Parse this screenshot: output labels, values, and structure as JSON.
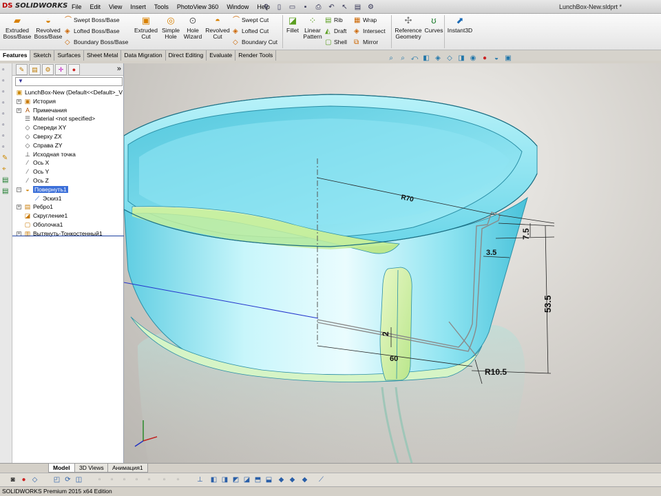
{
  "app": {
    "logo_prefix": "DS",
    "logo_name": "SOLIDWORKS",
    "document_title": "LunchBox-New.sldprt *"
  },
  "menu": [
    "File",
    "Edit",
    "View",
    "Insert",
    "Tools",
    "PhotoView 360",
    "Window",
    "Help"
  ],
  "ribbon": {
    "extruded_boss": "Extruded Boss/Base",
    "revolved_boss": "Revolved Boss/Base",
    "swept_boss": "Swept Boss/Base",
    "lofted_boss": "Lofted Boss/Base",
    "boundary_boss": "Boundary Boss/Base",
    "extruded_cut": "Extruded Cut",
    "simple_hole": "Simple Hole",
    "hole_wizard": "Hole Wizard",
    "revolved_cut": "Revolved Cut",
    "swept_cut": "Swept Cut",
    "lofted_cut": "Lofted Cut",
    "boundary_cut": "Boundary Cut",
    "fillet": "Fillet",
    "linear_pattern": "Linear Pattern",
    "rib": "Rib",
    "draft": "Draft",
    "shell": "Shell",
    "wrap": "Wrap",
    "intersect": "Intersect",
    "mirror": "Mirror",
    "reference_geometry": "Reference Geometry",
    "curves": "Curves",
    "instant3d": "Instant3D"
  },
  "command_tabs": [
    "Features",
    "Sketch",
    "Surfaces",
    "Sheet Metal",
    "Data Migration",
    "Direct Editing",
    "Evaluate",
    "Render Tools"
  ],
  "tree": {
    "root": "LunchBox-New  (Default<<Default>_V",
    "items": [
      {
        "label": "История",
        "icon": "history-icon",
        "glyph": "▣",
        "color": "#c87800",
        "expander": "+"
      },
      {
        "label": "Примечания",
        "icon": "annotations-icon",
        "glyph": "A",
        "color": "#b05000",
        "expander": "+"
      },
      {
        "label": "Material <not specified>",
        "icon": "material-icon",
        "glyph": "☰",
        "color": "#555",
        "expander": ""
      },
      {
        "label": "Спереди XY",
        "icon": "plane-icon",
        "glyph": "◇",
        "color": "#444",
        "expander": ""
      },
      {
        "label": "Сверху ZX",
        "icon": "plane-icon",
        "glyph": "◇",
        "color": "#444",
        "expander": ""
      },
      {
        "label": "Справа ZY",
        "icon": "plane-icon",
        "glyph": "◇",
        "color": "#444",
        "expander": ""
      },
      {
        "label": "Исходная точка",
        "icon": "origin-icon",
        "glyph": "⊥",
        "color": "#333",
        "expander": ""
      },
      {
        "label": "Ось X",
        "icon": "axis-icon",
        "glyph": "⁄",
        "color": "#555",
        "expander": ""
      },
      {
        "label": "Ось Y",
        "icon": "axis-icon",
        "glyph": "⁄",
        "color": "#555",
        "expander": ""
      },
      {
        "label": "Ось Z",
        "icon": "axis-icon",
        "glyph": "⁄",
        "color": "#555",
        "expander": ""
      },
      {
        "label": "Повернуть1",
        "icon": "revolve-icon",
        "glyph": "◒",
        "color": "#d08000",
        "expander": "−",
        "selected": true
      },
      {
        "label": "Эскиз1",
        "icon": "sketch-icon",
        "glyph": "⟋",
        "color": "#1050c0",
        "expander": "",
        "indent": true
      },
      {
        "label": "Ребро1",
        "icon": "rib-icon",
        "glyph": "▤",
        "color": "#c87800",
        "expander": "+"
      },
      {
        "label": "Скругление1",
        "icon": "fillet-icon",
        "glyph": "◪",
        "color": "#c87800",
        "expander": ""
      },
      {
        "label": "Оболочка1",
        "icon": "shell-icon",
        "glyph": "▢",
        "color": "#c87800",
        "expander": ""
      },
      {
        "label": "Вытянуть-Тонкостенный1",
        "icon": "extrude-thin-icon",
        "glyph": "▥",
        "color": "#c87800",
        "expander": "+"
      }
    ]
  },
  "dimensions": {
    "r70": "R70",
    "d75": "7.5",
    "d35": "3.5",
    "d535": "53.5",
    "d2": "2",
    "d60": "60",
    "r105": "R10.5"
  },
  "bottom_tabs": [
    "Model",
    "3D Views",
    "Анимация1"
  ],
  "status": "SOLIDWORKS Premium 2015 x64 Edition",
  "colors": {
    "body": "#7fe6f5",
    "rib": "#cdeea0",
    "selection": "#3b6fd9"
  }
}
